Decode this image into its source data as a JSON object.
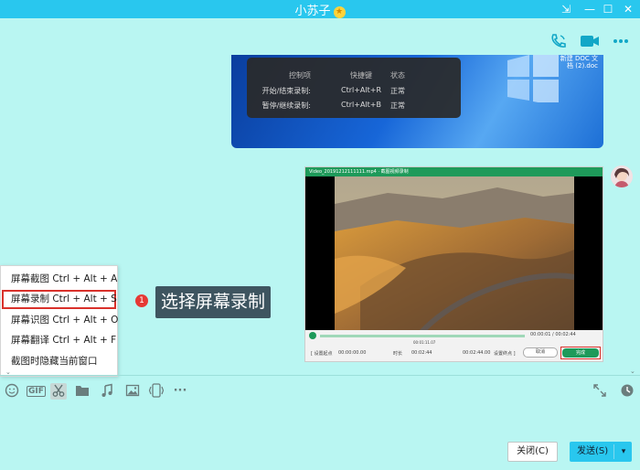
{
  "window": {
    "title": "小苏子",
    "star_glyph": "★",
    "controls": {
      "restore": "⇲",
      "minimize": "—",
      "maximize": "☐",
      "close": "✕"
    }
  },
  "header_icons": [
    "phone-call-icon",
    "video-call-icon",
    "more-icon"
  ],
  "messages": {
    "image1": {
      "desktop_label_line1": "新建 DOC 文",
      "desktop_label_line2": "档 (2).doc",
      "hotkey_panel": {
        "headers": [
          "控制项",
          "快捷键",
          "状态"
        ],
        "rows": [
          {
            "action": "开始/结束录制:",
            "key": "Ctrl+Alt+R",
            "status": "正常"
          },
          {
            "action": "暂停/继续录制:",
            "key": "Ctrl+Alt+B",
            "status": "正常"
          }
        ]
      }
    },
    "image2": {
      "window_title": "Video_20191212111111.mp4 · 截图视频录制",
      "time": "00:00:01 / 00:02:44",
      "marker": "00:01:11.07",
      "set_start": "[ 设置起点",
      "start_time": "00:00:00.00",
      "duration_label": "时长",
      "duration_value": "00:02:44",
      "end_time": "00:02:44.00",
      "set_end": "设置终点 ]",
      "cancel_label": "取消",
      "confirm_label": "完成"
    }
  },
  "annotation": {
    "number": "1",
    "text": "选择屏幕录制"
  },
  "screenshot_menu": {
    "items": [
      {
        "label": "屏幕截图 Ctrl + Alt + A",
        "selected": false
      },
      {
        "label": "屏幕录制 Ctrl + Alt + S",
        "selected": true
      },
      {
        "label": "屏幕识图 Ctrl + Alt + O",
        "selected": false
      },
      {
        "label": "屏幕翻译 Ctrl + Alt + F",
        "selected": false
      },
      {
        "label": "截图时隐藏当前窗口",
        "selected": false
      }
    ]
  },
  "toolbar": {
    "gif_label": "GIF",
    "more_label": "···"
  },
  "buttons": {
    "close_label": "关闭(C)",
    "send_label": "发送(S)",
    "send_arrow": "▾"
  },
  "colors": {
    "title_bar": "#29c7ee",
    "chat_background": "#b9f6f2",
    "selection_border": "#d9312b",
    "annotation_badge": "#e53935",
    "annotation_bg": "#3e5560"
  }
}
